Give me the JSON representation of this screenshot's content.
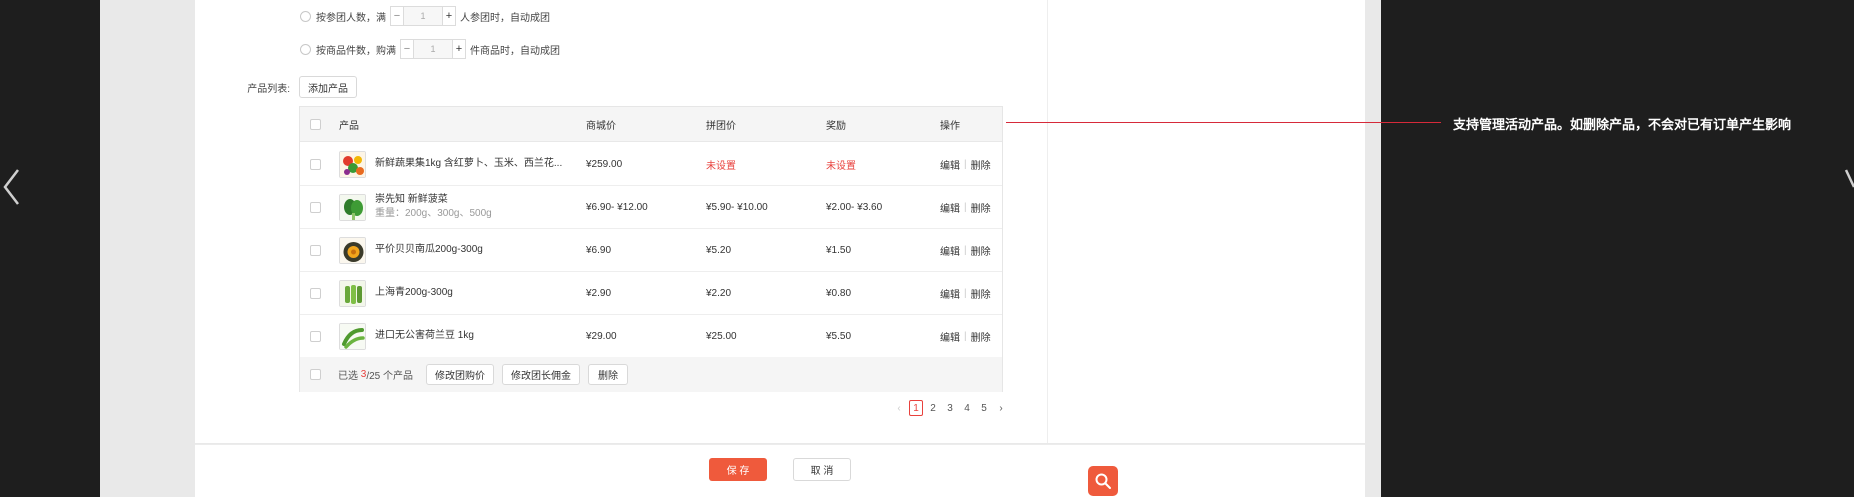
{
  "rules": {
    "by_people": {
      "prefix": "按参团人数，满",
      "value": "1",
      "suffix": "人参团时，自动成团",
      "minus": "−",
      "plus": "+"
    },
    "by_items": {
      "prefix": "按商品件数，购满",
      "value": "1",
      "suffix": "件商品时，自动成团",
      "minus": "−",
      "plus": "+"
    }
  },
  "product_list": {
    "label": "产品列表:",
    "add_button": "添加产品"
  },
  "table": {
    "headers": {
      "product": "产品",
      "mall_price": "商城价",
      "group_price": "拼团价",
      "reward": "奖励",
      "operation": "操作"
    },
    "rows": [
      {
        "name": "新鲜蔬果集1kg 含红萝卜、玉米、西兰花...",
        "sub": "",
        "mall_price": "¥259.00",
        "group_price": "未设置",
        "reward": "未设置",
        "thumb_icon": "mixed-vegetables-icon"
      },
      {
        "name": "崇先知 新鲜菠菜",
        "sub": "重量：200g、300g、500g",
        "mall_price": "¥6.90- ¥12.00",
        "group_price": "¥5.90- ¥10.00",
        "reward": "¥2.00- ¥3.60",
        "thumb_icon": "spinach-icon"
      },
      {
        "name": "平价贝贝南瓜200g-300g",
        "sub": "",
        "mall_price": "¥6.90",
        "group_price": "¥5.20",
        "reward": "¥1.50",
        "thumb_icon": "pumpkin-icon"
      },
      {
        "name": "上海青200g-300g",
        "sub": "",
        "mall_price": "¥2.90",
        "group_price": "¥2.20",
        "reward": "¥0.80",
        "thumb_icon": "bok-choy-icon"
      },
      {
        "name": "进口无公害荷兰豆 1kg",
        "sub": "",
        "mall_price": "¥29.00",
        "group_price": "¥25.00",
        "reward": "¥5.50",
        "thumb_icon": "snow-peas-icon"
      }
    ],
    "edit_label": "编辑",
    "delete_label": "删除",
    "footer": {
      "selected_prefix": "已选",
      "selected_count": "3",
      "selected_suffix": "/25 个产品",
      "modify_price": "修改团购价",
      "modify_commission": "修改团长佣金",
      "delete": "删除"
    }
  },
  "pagination": {
    "pages": [
      "1",
      "2",
      "3",
      "4",
      "5"
    ],
    "current": "1",
    "prev": "‹",
    "next": "›"
  },
  "annotation": "支持管理活动产品。如删除产品，不会对已有订单产生影响",
  "actions": {
    "save": "保 存",
    "cancel": "取 消"
  },
  "colors": {
    "accent": "#ef5a3c",
    "annotation_line": "#d62a3a",
    "price_unset": "#e8413d"
  }
}
